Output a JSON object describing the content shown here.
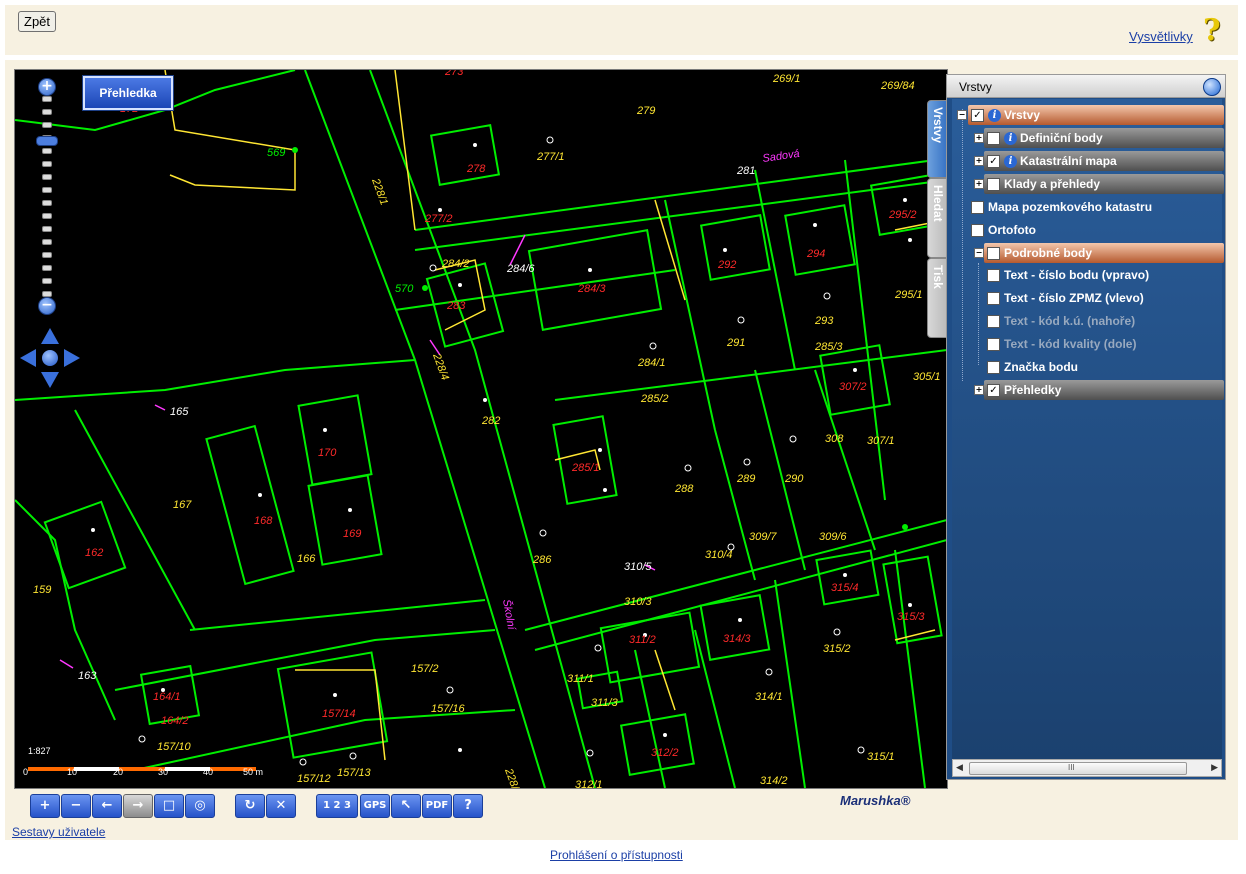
{
  "top": {
    "back_label": "Zpět",
    "explain_link": "Vysvětlivky"
  },
  "map": {
    "overview_button": "Přehledka",
    "scale_text": "1:827",
    "scale_ticks": [
      "0",
      "10",
      "20",
      "30",
      "40",
      "50 m"
    ],
    "scale_colors": [
      "#ff6a00",
      "#ffffff",
      "#ff6a00",
      "#ffffff",
      "#ff6a00"
    ],
    "parcels_yellow": [
      "279",
      "277/1",
      "281",
      "293",
      "291",
      "284/1",
      "295/1",
      "305/1",
      "308",
      "307/1",
      "288",
      "289",
      "290",
      "282",
      "286",
      "167",
      "166",
      "159",
      "157/2",
      "157/16",
      "157/10",
      "157/12",
      "157/13",
      "315/2",
      "314/1",
      "311/1",
      "311/3",
      "312/1",
      "314/2",
      "315/1",
      "310/3",
      "310/5",
      "309/7",
      "309/6",
      "310/4",
      "285/3",
      "285/2",
      "284/2",
      "269/1",
      "269/84",
      "228/1",
      "228/4",
      "228/3"
    ],
    "parcels_red": [
      "278",
      "277/2",
      "295/2",
      "292",
      "294",
      "284/3",
      "283",
      "307/2",
      "285/1",
      "170",
      "168",
      "169",
      "162",
      "164/1",
      "164/2",
      "157/14",
      "315/4",
      "315/3",
      "311/2",
      "314/3",
      "312/2",
      "172",
      "273"
    ],
    "parcels_white": [
      "281",
      "284/6",
      "165",
      "163",
      "310/5"
    ],
    "point_labels": [
      "569",
      "570"
    ],
    "street_labels": [
      "Sadová",
      "Školní"
    ],
    "line_color": "#00ee00",
    "building_label_color": "#ff2a2a",
    "parcel_label_color": "#ffe633"
  },
  "toolbar": {
    "buttons": [
      "zoom-in",
      "zoom-out",
      "back",
      "forward",
      "zoom-extent",
      "globe",
      "refresh",
      "clear",
      "numbering",
      "gps",
      "select",
      "pdf",
      "help"
    ],
    "gps_label": "GPS",
    "numbering_label": "1 2 3",
    "help_label": "?",
    "pdf_label": "PDF"
  },
  "brand": "Marushka®",
  "tabs": {
    "vrstvy": "Vrstvy",
    "hledat": "Hledat",
    "tisk": "Tisk"
  },
  "layers_panel": {
    "title": "Vrstvy",
    "rows": [
      {
        "label": "Vrstvy",
        "checked": true
      },
      {
        "label": "Definiční body",
        "checked": false
      },
      {
        "label": "Katastrální mapa",
        "checked": true
      },
      {
        "label": "Klady a přehledy",
        "checked": false
      },
      {
        "label": "Mapa pozemkového katastru",
        "checked": false
      },
      {
        "label": "Ortofoto",
        "checked": false
      },
      {
        "label": "Podrobné body",
        "checked": false
      },
      {
        "label": "Text - číslo bodu (vpravo)",
        "checked": false
      },
      {
        "label": "Text - číslo ZPMZ (vlevo)",
        "checked": false
      },
      {
        "label": "Text - kód k.ú. (nahoře)",
        "checked": false
      },
      {
        "label": "Text - kód kvality (dole)",
        "checked": false
      },
      {
        "label": "Značka bodu",
        "checked": false
      },
      {
        "label": "Přehledky",
        "checked": true
      }
    ],
    "scroll_mark": "III"
  },
  "footer": {
    "sestavy": "Sestavy uživatele",
    "prohlaseni": "Prohlášení o přístupnosti"
  }
}
